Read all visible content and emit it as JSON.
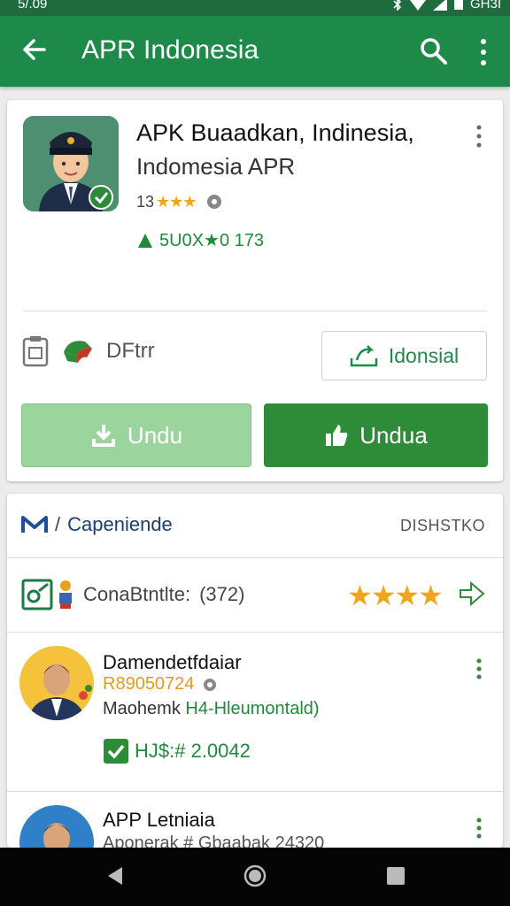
{
  "status_bar": {
    "time": "5/.09",
    "right_text": "GH3I"
  },
  "app_bar": {
    "title": "APR Indonesia"
  },
  "app": {
    "name": "APK Buaadkan, Indinesia,",
    "subtitle": "Indomesia APR",
    "rating_text": "13",
    "rating_stars": "★★★",
    "download_count": "5U0X★0 173"
  },
  "meta": {
    "label": "DFtrr"
  },
  "language_button": {
    "label": "Idonsial"
  },
  "buttons": {
    "download_light": "Undu",
    "download_dark": "Undua"
  },
  "section": {
    "title_prefix": "/",
    "title": "Capeniende",
    "action": "DISHSTKO"
  },
  "rating_summary": {
    "label": "ConaBtntlte:",
    "count": "(372)",
    "stars": "★★★★"
  },
  "reviews": [
    {
      "name": "Damendetfdaiar",
      "date": "R89050724",
      "desc_prefix": "Maohemk",
      "desc_highlight": "H4-Hleumontald)",
      "badge_text": "HJ$:# 2.0042"
    },
    {
      "name": "APP Letniaia",
      "desc": "Aponerak # Gbaabak 24320"
    }
  ],
  "colors": {
    "appbar": "#1d8a4a",
    "statusbar": "#1e6b3e",
    "accent_green": "#2e8b37",
    "star": "#f2a51a"
  }
}
